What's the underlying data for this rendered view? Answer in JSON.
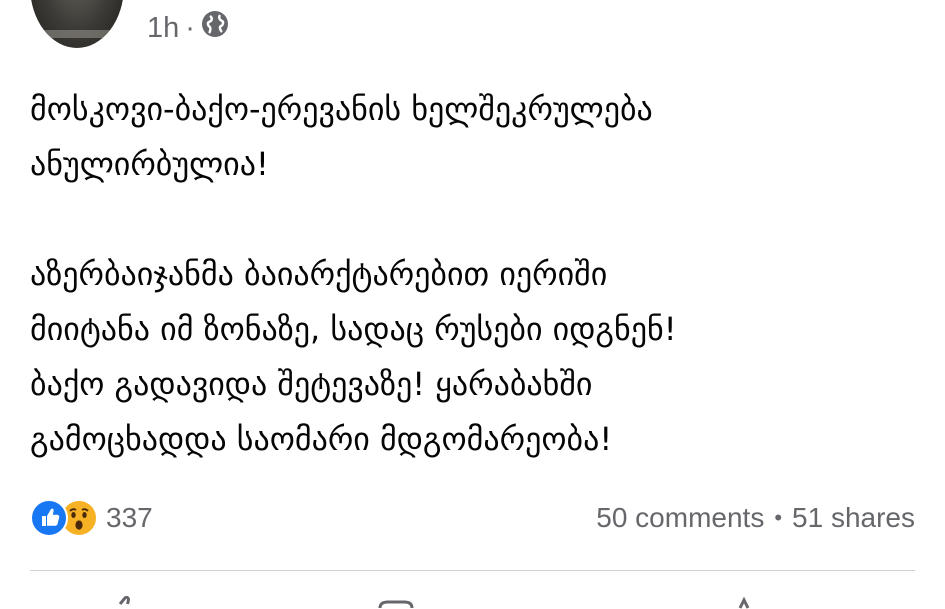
{
  "header": {
    "time": "1h",
    "separator": "·",
    "privacy_icon": "globe-icon"
  },
  "post": {
    "paragraph1": [
      "მოსკოვი-ბაქო-ერევანის ხელშეკრულება",
      "ანულირბულია!"
    ],
    "paragraph2": [
      "აზერბაიჯანმა ბაიარქტარებით იერიში",
      "მიიტანა იმ ზონაზე, სადაც რუსები იდგნენ!",
      "ბაქო გადავიდა შეტევაზე! ყარაბახში",
      "გამოცხადდა საომარი მდგომარეობა!"
    ]
  },
  "reactions": {
    "icons": [
      "like-icon",
      "wow-icon"
    ],
    "count": "337"
  },
  "stats": {
    "comments": "50 comments",
    "separator": "•",
    "shares": "51 shares"
  },
  "colors": {
    "like": "#1877f2",
    "wow": "#f7b125",
    "secondary_text": "#65676b",
    "divider": "#ced0d4"
  }
}
